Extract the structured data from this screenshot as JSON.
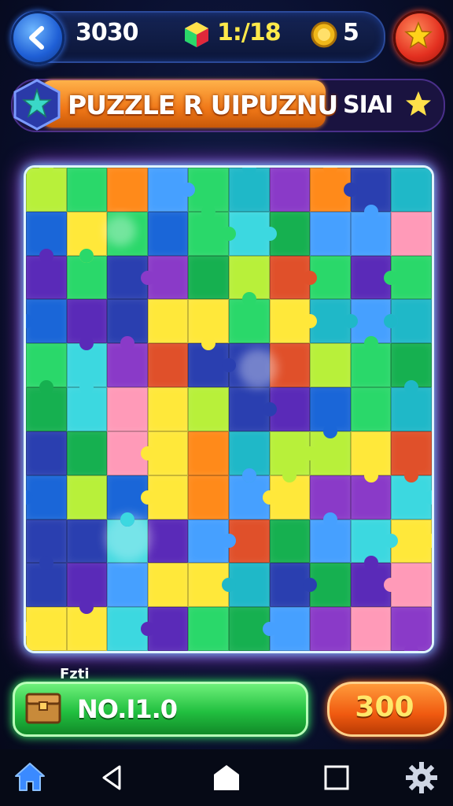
{
  "header": {
    "score": "3030",
    "gems": "1:/18",
    "coins": "5",
    "icons": {
      "back": "back-arrow-icon",
      "gem": "gem-icon",
      "coin": "coin-icon",
      "star": "star-icon"
    }
  },
  "banner": {
    "title": "PUZZLE R UIPUZNU",
    "right_text": "SIAI"
  },
  "board": {
    "rows": 11,
    "cols": 10,
    "palette": [
      "#2a3fb0",
      "#1fb8c8",
      "#3cd8e0",
      "#2ad86a",
      "#16b050",
      "#ffe83a",
      "#b8f03a",
      "#ff8a1a",
      "#ff9ab8",
      "#8a3ac8",
      "#5a2ab8",
      "#e0502a",
      "#46a0ff",
      "#1a66d8"
    ]
  },
  "bottom": {
    "label": "Fzti",
    "green_text": "NO.I1.0",
    "button_value": "300"
  },
  "nav": {
    "items": [
      "home-icon",
      "back-triangle-icon",
      "home-shape-icon",
      "square-icon",
      "gear-icon"
    ]
  }
}
